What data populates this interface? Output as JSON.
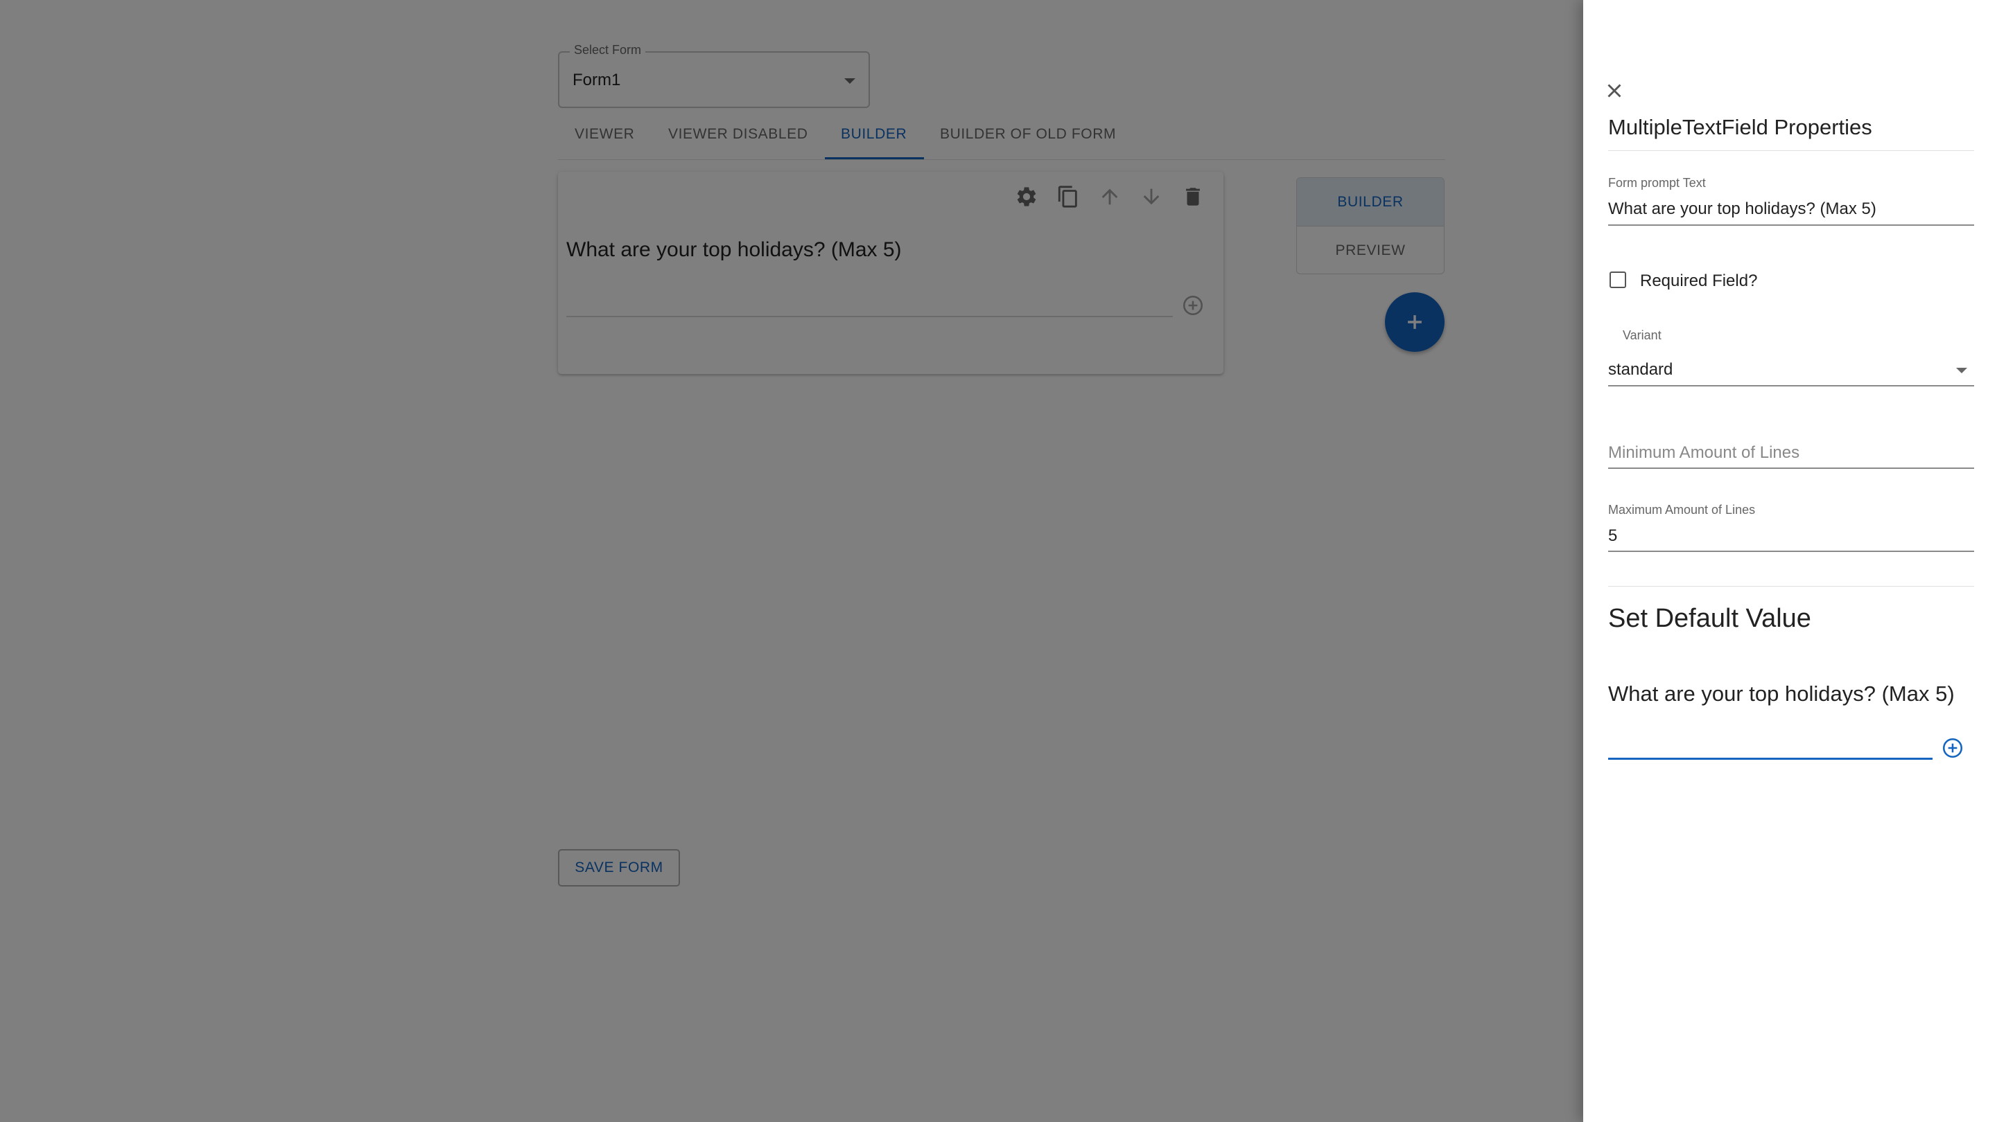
{
  "form_select": {
    "label": "Select Form",
    "value": "Form1"
  },
  "tabs": [
    {
      "label": "VIEWER",
      "active": false
    },
    {
      "label": "VIEWER DISABLED",
      "active": false
    },
    {
      "label": "BUILDER",
      "active": true
    },
    {
      "label": "BUILDER OF OLD FORM",
      "active": false
    }
  ],
  "field_card": {
    "question": "What are your top holidays? (Max 5)",
    "toolbar_icons": [
      "gear-icon",
      "copy-icon",
      "arrow-up-icon",
      "arrow-down-icon",
      "trash-icon"
    ],
    "add_icon": "add-circle-icon"
  },
  "mode_toggle": {
    "builder_label": "BUILDER",
    "preview_label": "PREVIEW",
    "selected": "BUILDER"
  },
  "fab_icon": "plus-icon",
  "save_button": {
    "label": "SAVE FORM"
  },
  "drawer": {
    "close_icon": "close-icon",
    "title": "MultipleTextField Properties",
    "prompt": {
      "label": "Form prompt Text",
      "value": "What are your top holidays? (Max 5)"
    },
    "required": {
      "label": "Required Field?",
      "checked": false
    },
    "variant": {
      "label": "Variant",
      "value": "standard"
    },
    "min_lines": {
      "placeholder": "Minimum Amount of Lines",
      "value": ""
    },
    "max_lines": {
      "label": "Maximum Amount of Lines",
      "value": "5"
    },
    "default_section": {
      "title": "Set Default Value",
      "question": "What are your top holidays? (Max 5)",
      "add_icon": "add-circle-icon"
    }
  },
  "colors": {
    "accent": "#1565c0",
    "backdrop": "rgba(0,0,0,0.5)",
    "drawer_bg": "#ffffff"
  }
}
